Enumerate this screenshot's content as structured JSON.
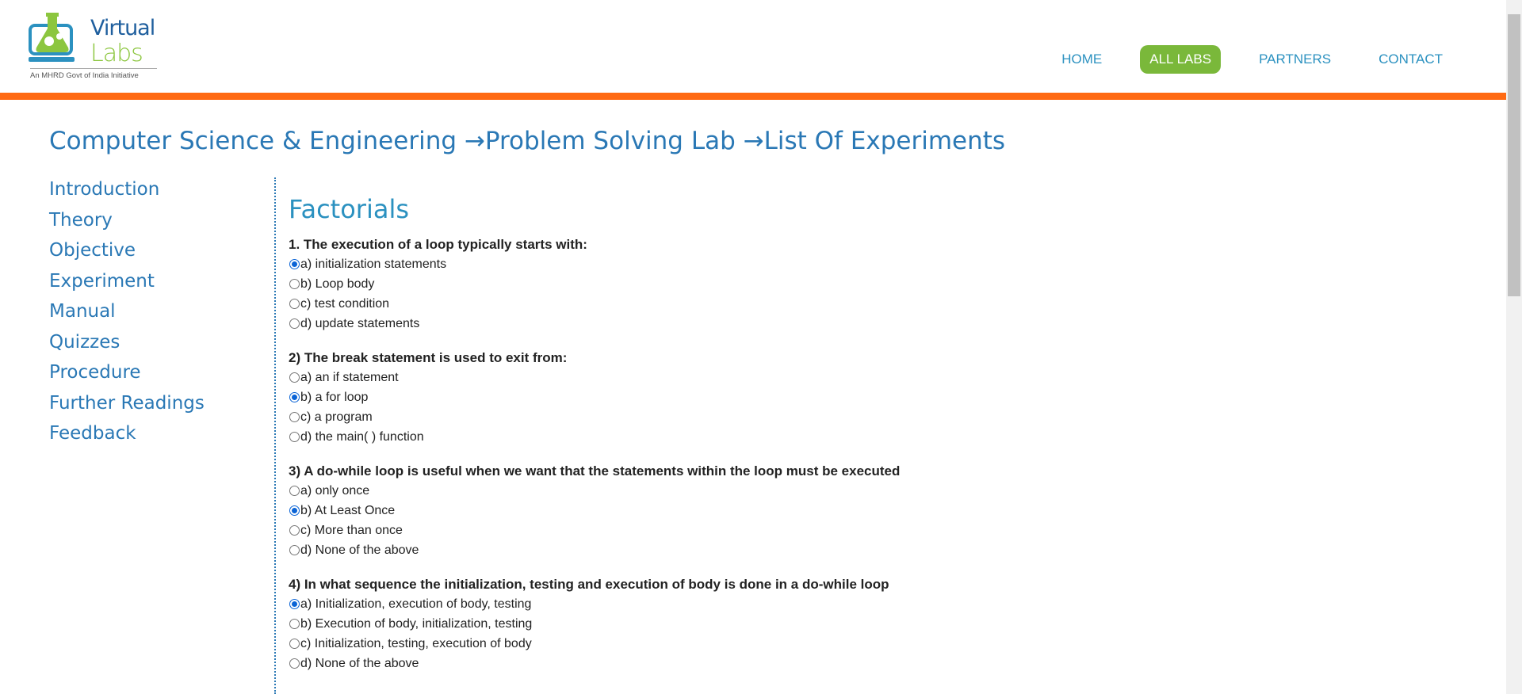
{
  "header": {
    "logo": {
      "line1": "Virtual",
      "line2": "Labs",
      "subtitle": "An MHRD Govt of India Initiative"
    },
    "nav": [
      {
        "label": "HOME",
        "active": false
      },
      {
        "label": "ALL LABS",
        "active": true
      },
      {
        "label": "PARTNERS",
        "active": false
      },
      {
        "label": "CONTACT",
        "active": false
      }
    ]
  },
  "breadcrumb": "Computer Science & Engineering →Problem Solving Lab →List Of Experiments",
  "sidebar": {
    "items": [
      "Introduction",
      "Theory",
      "Objective",
      "Experiment",
      "Manual",
      "Quizzes",
      "Procedure",
      "Further Readings",
      "Feedback"
    ]
  },
  "main": {
    "title": "Factorials",
    "questions": [
      {
        "text": "1. The execution of a loop typically starts with:",
        "options": [
          "a) initialization statements",
          "b) Loop body",
          "c) test condition",
          "d) update statements"
        ],
        "selected": 0
      },
      {
        "text": "2) The break statement is used to exit from:",
        "options": [
          "a) an if statement",
          "b) a for loop",
          "c) a program",
          "d) the main( ) function"
        ],
        "selected": 1
      },
      {
        "text": "3) A do-while loop is useful when we want that the statements within the loop must be executed",
        "options": [
          "a) only once",
          "b) At Least Once",
          "c) More than once",
          "d) None of the above"
        ],
        "selected": 1
      },
      {
        "text": "4) In what sequence the initialization, testing and execution of body is done in a do-while loop",
        "options": [
          "a) Initialization, execution of body, testing",
          "b) Execution of body, initialization, testing",
          "c) Initialization, testing, execution of body",
          "d) None of the above"
        ],
        "selected": 0
      }
    ]
  },
  "colors": {
    "accent": "#2a78b5",
    "orange_bar": "#ff6a13",
    "active_nav": "#7ab83a",
    "radio_checked": "#0b64d6"
  }
}
